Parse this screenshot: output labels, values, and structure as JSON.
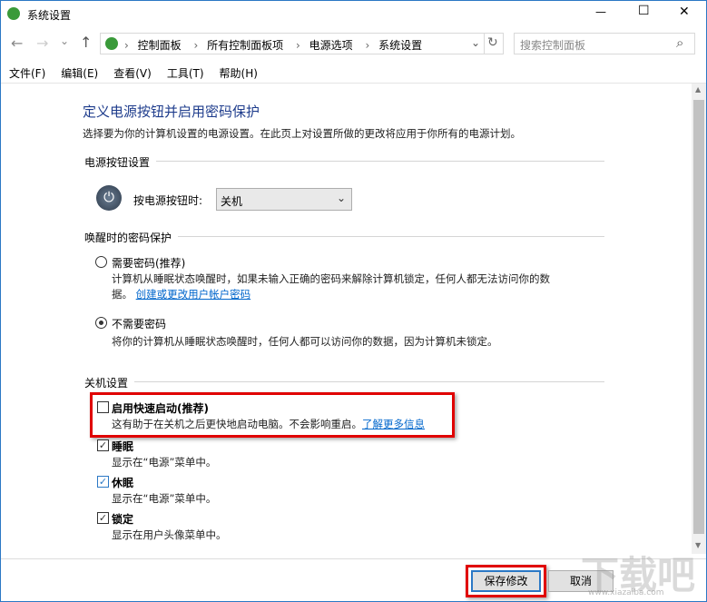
{
  "window": {
    "title": "系统设置",
    "minimize": "—",
    "maximize": "☐",
    "close": "✕"
  },
  "nav": {
    "back": "←",
    "forward": "→",
    "recent": "⌄",
    "up": "↑",
    "breadcrumb": [
      "控制面板",
      "所有控制面板项",
      "电源选项",
      "系统设置"
    ],
    "separator": "›",
    "dropdown": "⌄",
    "refresh": "↻",
    "search_placeholder": "搜索控制面板",
    "search_icon": "⌕"
  },
  "menu": [
    "文件(F)",
    "编辑(E)",
    "查看(V)",
    "工具(T)",
    "帮助(H)"
  ],
  "main": {
    "title": "定义电源按钮并启用密码保护",
    "description": "选择要为你的计算机设置的电源设置。在此页上对设置所做的更改将应用于你所有的电源计划。",
    "power_section": {
      "heading": "电源按钮设置",
      "label": "按电源按钮时:",
      "value": "关机"
    },
    "password_section": {
      "heading": "唤醒时的密码保护",
      "options": [
        {
          "label": "需要密码(推荐)",
          "desc1": "计算机从睡眠状态唤醒时，如果未输入正确的密码来解除计算机锁定，任何人都无法访问你的数",
          "desc2": "据。",
          "link": "创建或更改用户帐户密码",
          "selected": false
        },
        {
          "label": "不需要密码",
          "desc1": "将你的计算机从睡眠状态唤醒时，任何人都可以访问你的数据，因为计算机未锁定。",
          "selected": true
        }
      ]
    },
    "shutdown_section": {
      "heading": "关机设置",
      "items": [
        {
          "label": "启用快速启动(推荐)",
          "desc": "这有助于在关机之后更快地启动电脑。不会影响重启。",
          "link": "了解更多信息",
          "checked": false
        },
        {
          "label": "睡眠",
          "desc": "显示在“电源”菜单中。",
          "checked": true
        },
        {
          "label": "休眠",
          "desc": "显示在“电源”菜单中。",
          "checked": true
        },
        {
          "label": "锁定",
          "desc": "显示在用户头像菜单中。",
          "checked": true
        }
      ]
    }
  },
  "footer": {
    "save": "保存修改",
    "cancel": "取消"
  },
  "watermark": {
    "text": "下载吧",
    "url": "www.xiazaiba.com"
  },
  "colors": {
    "title": "#1e3c8c",
    "highlight": "#e00000",
    "link": "#0066cc"
  }
}
